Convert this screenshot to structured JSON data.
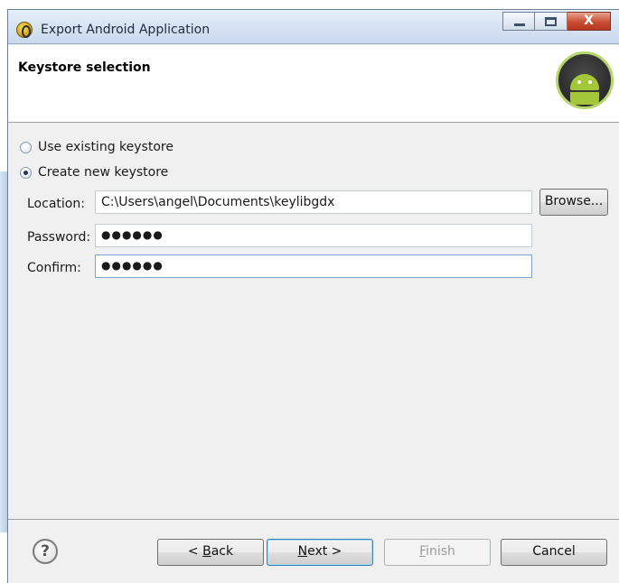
{
  "window": {
    "title": "Export Android Application",
    "controls": {
      "minimize": "minimize",
      "maximize": "maximize",
      "close": "X"
    }
  },
  "header": {
    "title": "Keystore selection",
    "logo_icon": "android-robot-icon",
    "accent_color": "#a4c639"
  },
  "options": {
    "use_existing": {
      "label": "Use existing keystore",
      "checked": false
    },
    "create_new": {
      "label": "Create new keystore",
      "checked": true
    }
  },
  "fields": {
    "location": {
      "label": "Location:",
      "value": "C:\\Users\\angel\\Documents\\keylibgdx"
    },
    "password": {
      "label": "Password:",
      "value": "●●●●●●"
    },
    "confirm": {
      "label": "Confirm:",
      "value": "●●●●●●"
    }
  },
  "buttons": {
    "browse": "Browse...",
    "back_prefix": "< ",
    "back_mnemonic": "B",
    "back_rest": "ack",
    "next_mnemonic": "N",
    "next_rest": "ext >",
    "finish_mnemonic": "F",
    "finish_rest": "inish",
    "cancel": "Cancel"
  },
  "footer": {
    "help_icon": "question-mark-icon",
    "help_glyph": "?"
  }
}
